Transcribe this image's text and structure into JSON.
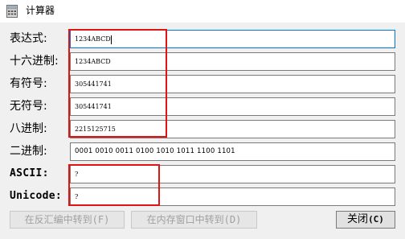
{
  "window": {
    "title": "计算器",
    "app_icon": "calculator-icon"
  },
  "rows": {
    "expression": {
      "label": "表达式:",
      "value": "1234ABCD"
    },
    "hex": {
      "label": "十六进制:",
      "value": "1234ABCD"
    },
    "signed": {
      "label": "有符号:",
      "value": "305441741"
    },
    "unsigned": {
      "label": "无符号:",
      "value": "305441741"
    },
    "octal": {
      "label": "八进制:",
      "value": "2215125715"
    },
    "binary": {
      "label": "二进制:",
      "value": "0001 0010 0011 0100 1010 1011 1100 1101"
    },
    "ascii": {
      "label": "ASCII:",
      "value": "?"
    },
    "unicode": {
      "label": "Unicode:",
      "value": "?"
    }
  },
  "buttons": {
    "goto_disasm": "在反汇编中转到(F)",
    "goto_memory": "在内存窗口中转到(D)",
    "close_text": "关闭",
    "close_key": "(C)"
  },
  "colors": {
    "highlight": "#e01414",
    "focus_border": "#0078d7",
    "background": "#f0f0f0"
  }
}
